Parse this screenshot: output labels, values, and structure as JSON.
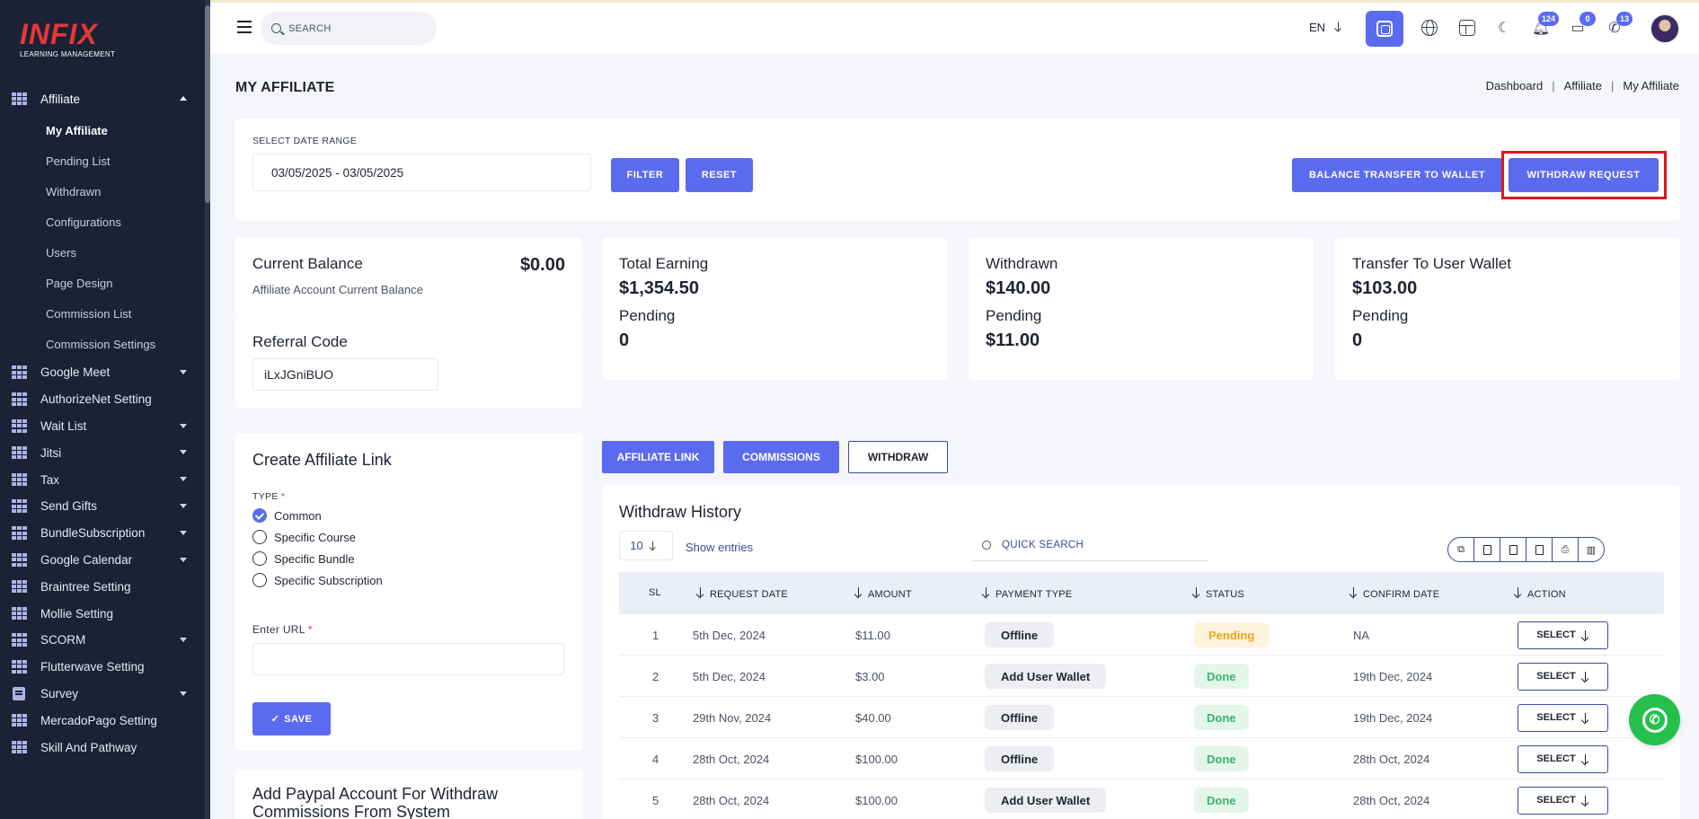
{
  "brand": {
    "name": "INFIX",
    "tagline": "LEARNING MANAGEMENT",
    "accent": "#5b6bf0",
    "logo_color": "#e53935"
  },
  "topbar": {
    "search_placeholder": "SEARCH",
    "language": "EN",
    "notifications_count": "124",
    "messages_count": "0",
    "whatsapp_count": "13"
  },
  "sidebar": {
    "affiliate_label": "Affiliate",
    "affiliate_children": [
      "My Affiliate",
      "Pending List",
      "Withdrawn",
      "Configurations",
      "Users",
      "Page Design",
      "Commission List",
      "Commission Settings"
    ],
    "items": [
      {
        "label": "Google Meet",
        "caret": true,
        "icon": "grid-icon"
      },
      {
        "label": "AuthorizeNet Setting",
        "caret": false,
        "icon": "grid-icon"
      },
      {
        "label": "Wait List",
        "caret": true,
        "icon": "grid-icon"
      },
      {
        "label": "Jitsi",
        "caret": true,
        "icon": "grid-icon"
      },
      {
        "label": "Tax",
        "caret": true,
        "icon": "grid-icon"
      },
      {
        "label": "Send Gifts",
        "caret": true,
        "icon": "grid-icon"
      },
      {
        "label": "BundleSubscription",
        "caret": true,
        "icon": "grid-icon"
      },
      {
        "label": "Google Calendar",
        "caret": true,
        "icon": "grid-icon"
      },
      {
        "label": "Braintree Setting",
        "caret": false,
        "icon": "grid-icon"
      },
      {
        "label": "Mollie Setting",
        "caret": false,
        "icon": "grid-icon"
      },
      {
        "label": "SCORM",
        "caret": true,
        "icon": "grid-icon"
      },
      {
        "label": "Flutterwave Setting",
        "caret": false,
        "icon": "grid-icon"
      },
      {
        "label": "Survey",
        "caret": true,
        "icon": "doc-icon"
      },
      {
        "label": "MercadoPago Setting",
        "caret": false,
        "icon": "grid-icon"
      },
      {
        "label": "Skill And Pathway",
        "caret": false,
        "icon": "grid-icon"
      }
    ]
  },
  "page": {
    "title": "MY AFFILIATE",
    "breadcrumb": [
      "Dashboard",
      "Affiliate",
      "My Affiliate"
    ]
  },
  "filter": {
    "date_label": "SELECT DATE RANGE",
    "date_value": "03/05/2025 - 03/05/2025",
    "filter_btn": "FILTER",
    "reset_btn": "RESET",
    "transfer_btn": "BALANCE TRANSFER TO WALLET",
    "withdraw_btn": "WITHDRAW REQUEST"
  },
  "balance": {
    "title": "Current Balance",
    "amount": "$0.00",
    "subtitle": "Affiliate Account Current Balance",
    "referral_label": "Referral Code",
    "referral_code": "iLxJGniBUO"
  },
  "stats": [
    {
      "title": "Total Earning",
      "value": "$1,354.50",
      "sub": "Pending",
      "sub_value": "0"
    },
    {
      "title": "Withdrawn",
      "value": "$140.00",
      "sub": "Pending",
      "sub_value": "$11.00"
    },
    {
      "title": "Transfer To User Wallet",
      "value": "$103.00",
      "sub": "Pending",
      "sub_value": "0"
    }
  ],
  "link_form": {
    "title": "Create Affiliate Link",
    "type_label": "TYPE",
    "required_mark": "*",
    "options": [
      "Common",
      "Specific Course",
      "Specific Bundle",
      "Specific Subscription"
    ],
    "selected_index": 0,
    "url_label": "Enter URL",
    "save_btn": "SAVE"
  },
  "paypal": {
    "title": "Add Paypal Account For Withdraw Commissions From System"
  },
  "tabs": [
    "AFFILIATE LINK",
    "COMMISSIONS",
    "WITHDRAW"
  ],
  "history": {
    "title": "Withdraw History",
    "entries_value": "10",
    "entries_label": "Show entries",
    "quick_search": "QUICK SEARCH",
    "columns": [
      "SL",
      "REQUEST DATE",
      "AMOUNT",
      "PAYMENT TYPE",
      "STATUS",
      "CONFIRM DATE",
      "ACTION"
    ],
    "rows": [
      {
        "sl": "1",
        "date": "5th Dec, 2024",
        "amount": "$11.00",
        "type": "Offline",
        "status": "Pending",
        "status_kind": "pending",
        "confirm": "NA",
        "action": "SELECT"
      },
      {
        "sl": "2",
        "date": "5th Dec, 2024",
        "amount": "$3.00",
        "type": "Add User Wallet",
        "status": "Done",
        "status_kind": "done",
        "confirm": "19th Dec, 2024",
        "action": "SELECT"
      },
      {
        "sl": "3",
        "date": "29th Nov, 2024",
        "amount": "$40.00",
        "type": "Offline",
        "status": "Done",
        "status_kind": "done",
        "confirm": "19th Dec, 2024",
        "action": "SELECT"
      },
      {
        "sl": "4",
        "date": "28th Oct, 2024",
        "amount": "$100.00",
        "type": "Offline",
        "status": "Done",
        "status_kind": "done",
        "confirm": "28th Oct, 2024",
        "action": "SELECT"
      },
      {
        "sl": "5",
        "date": "28th Oct, 2024",
        "amount": "$100.00",
        "type": "Add User Wallet",
        "status": "Done",
        "status_kind": "done",
        "confirm": "28th Oct, 2024",
        "action": "SELECT"
      }
    ]
  }
}
